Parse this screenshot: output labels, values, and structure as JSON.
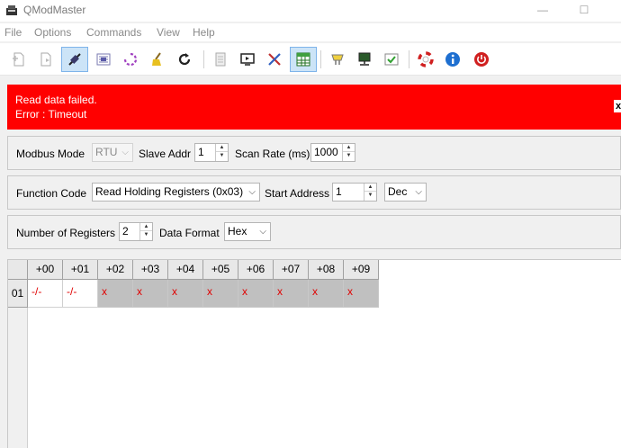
{
  "window": {
    "title": "QModMaster",
    "minimize_glyph": "—",
    "maximize_glyph": "☐"
  },
  "menu": [
    "File",
    "Options",
    "Commands",
    "View",
    "Help"
  ],
  "toolbar": {
    "buttons": [
      "new-file-icon",
      "open-file-icon",
      "connect-icon",
      "read-write-icon",
      "scan-icon",
      "clear-icon",
      "reset-icon",
      "log-icon",
      "bus-monitor-icon",
      "tools-icon",
      "table-icon",
      "serial-port-icon",
      "tcp-icon",
      "settings-icon",
      "help-icon",
      "about-icon",
      "exit-icon"
    ],
    "active": [
      "connect-icon",
      "table-icon"
    ]
  },
  "error": {
    "line1": "Read data failed.",
    "line2": "Error : Timeout",
    "close": "x"
  },
  "row1": {
    "modbus_mode_label": "Modbus Mode",
    "modbus_mode_value": "RTU",
    "slave_addr_label": "Slave Addr",
    "slave_addr_value": "1",
    "scan_rate_label": "Scan Rate (ms)",
    "scan_rate_value": "1000"
  },
  "row2": {
    "function_code_label": "Function Code",
    "function_code_value": "Read Holding Registers (0x03)",
    "start_address_label": "Start Address",
    "start_address_value": "1",
    "address_format_value": "Dec"
  },
  "row3": {
    "num_registers_label": "Number of Registers",
    "num_registers_value": "2",
    "data_format_label": "Data Format",
    "data_format_value": "Hex"
  },
  "table": {
    "columns": [
      "+00",
      "+01",
      "+02",
      "+03",
      "+04",
      "+05",
      "+06",
      "+07",
      "+08",
      "+09"
    ],
    "row_label": "01",
    "cells": [
      "-/-",
      "-/-",
      "x",
      "x",
      "x",
      "x",
      "x",
      "x",
      "x",
      "x"
    ]
  },
  "colors": {
    "error_bg": "#ff0000",
    "cell_value": "#e00000",
    "active_tool": "#cce4f7"
  }
}
